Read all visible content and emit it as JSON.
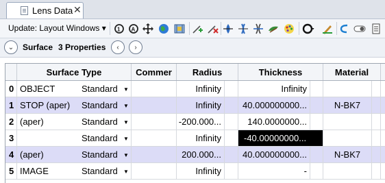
{
  "tab": {
    "label": "Lens Data",
    "close": "✕"
  },
  "toolbar": {
    "update_label": "Update: Layout Windows ▾"
  },
  "surface_bar": {
    "title": "Surface",
    "properties": "3 Properties",
    "expand": "⌄",
    "prev": "‹",
    "next": "›"
  },
  "columns": [
    "Surface Type",
    "Commer",
    "Radius",
    "Thickness",
    "Material"
  ],
  "rows": [
    {
      "idx": "0",
      "comment": "OBJECT",
      "type": "Standard",
      "radius": "Infinity",
      "thickness": "Infinity",
      "material": "",
      "selected": false
    },
    {
      "idx": "1",
      "comment": "STOP (aper)",
      "type": "Standard",
      "radius": "Infinity",
      "thickness": "40.000000000...",
      "material": "N-BK7",
      "selected": true
    },
    {
      "idx": "2",
      "comment": "(aper)",
      "type": "Standard",
      "radius": "-200.000...",
      "thickness": "140.0000000...",
      "material": "",
      "selected": false
    },
    {
      "idx": "3",
      "comment": "",
      "type": "Standard",
      "radius": "Infinity",
      "thickness": "-40.00000000...",
      "material": "",
      "selected": false
    },
    {
      "idx": "4",
      "comment": "(aper)",
      "type": "Standard",
      "radius": "200.000...",
      "thickness": "40.000000000...",
      "material": "N-BK7",
      "selected": true
    },
    {
      "idx": "5",
      "comment": "IMAGE",
      "type": "Standard",
      "radius": "Infinity",
      "thickness": "-",
      "material": "",
      "selected": false
    }
  ]
}
